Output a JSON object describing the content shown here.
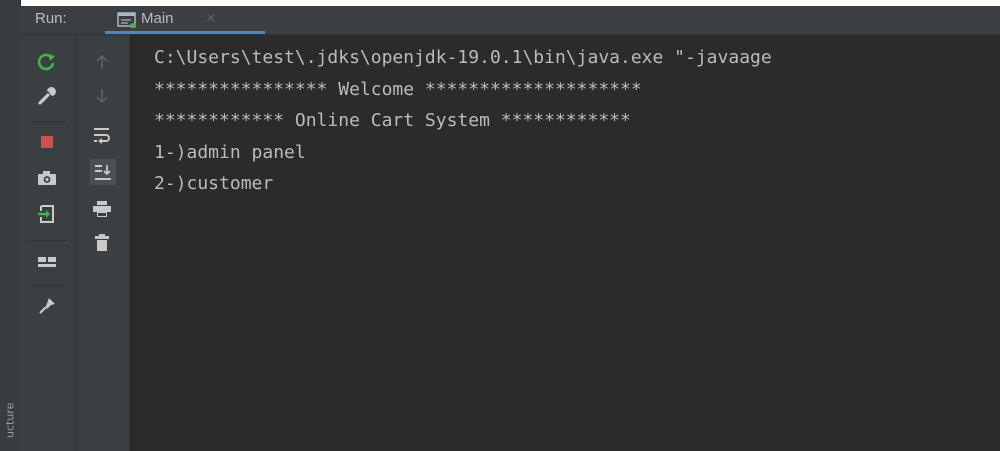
{
  "left_strip": {
    "label": "ucture"
  },
  "panel": {
    "run_label": "Run:",
    "tab": {
      "label": "Main",
      "close_glyph": "×"
    }
  },
  "colors": {
    "background": "#2b2b2b",
    "toolbar_bg": "#3c3f41",
    "text": "#bbbbbb",
    "rerun_green": "#3fb54a",
    "stop_red": "#c75450",
    "tab_underline": "#4a88c7"
  },
  "toolbar_left": [
    {
      "icon": "rerun-icon",
      "enabled": true
    },
    {
      "icon": "wrench-icon",
      "enabled": true
    },
    {
      "icon": "stop-icon",
      "enabled": true
    },
    {
      "icon": "camera-icon",
      "enabled": true
    },
    {
      "icon": "exit-icon",
      "enabled": true
    },
    {
      "icon": "layout-icon",
      "enabled": true
    },
    {
      "icon": "pin-icon",
      "enabled": true
    }
  ],
  "toolbar_right": [
    {
      "icon": "arrow-up-icon",
      "enabled": false
    },
    {
      "icon": "arrow-down-icon",
      "enabled": false
    },
    {
      "icon": "soft-wrap-icon",
      "enabled": true
    },
    {
      "icon": "scroll-to-end-icon",
      "enabled": true,
      "active": true
    },
    {
      "icon": "print-icon",
      "enabled": true
    },
    {
      "icon": "trash-icon",
      "enabled": true
    }
  ],
  "console": {
    "lines": [
      "C:\\Users\\test\\.jdks\\openjdk-19.0.1\\bin\\java.exe \"-javaage",
      "**************** Welcome ********************",
      "************ Online Cart System ************",
      "1-)admin panel",
      "2-)customer"
    ]
  }
}
